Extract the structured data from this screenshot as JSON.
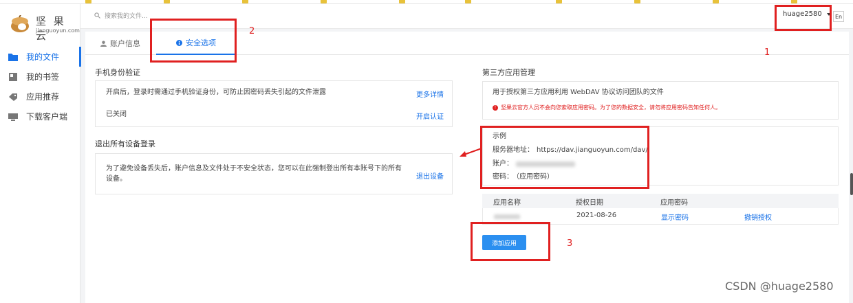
{
  "app": {
    "logo_name": "坚 果 云",
    "logo_url": "jianguoyun.com"
  },
  "sidebar": {
    "items": [
      {
        "label": "我的文件",
        "icon": "folder-icon",
        "active": true
      },
      {
        "label": "我的书签",
        "icon": "bookmark-icon",
        "active": false
      },
      {
        "label": "应用推荐",
        "icon": "tag-icon",
        "active": false
      },
      {
        "label": "下载客户端",
        "icon": "monitor-icon",
        "active": false
      }
    ]
  },
  "header": {
    "search_placeholder": "搜索我的文件...",
    "username": "huage2580",
    "lang_button": "En"
  },
  "tabs": [
    {
      "label": "账户信息",
      "icon": "user-icon",
      "active": false
    },
    {
      "label": "安全选项",
      "icon": "info-icon",
      "active": true
    }
  ],
  "phone_verify": {
    "title": "手机身份验证",
    "desc": "开启后，登录时需通过手机验证身份，可防止因密码丢失引起的文件泄露",
    "more_link": "更多详情",
    "status": "已关闭",
    "enable_link": "开启认证"
  },
  "logout_all": {
    "title": "退出所有设备登录",
    "desc_line1": "为了避免设备丢失后，账户信息及文件处于不安全状态，您可以在此强制登出所有本账号下的所有",
    "desc_line2": "设备。",
    "link": "退出设备"
  },
  "third_party": {
    "title": "第三方应用管理",
    "desc": "用于授权第三方应用利用 WebDAV 协议访问团队的文件",
    "warning": "坚果云官方人员不会向您索取应用密码。为了您的数据安全，请勿将应用密码告知任何人。",
    "example_title": "示例",
    "server_label": "服务器地址：",
    "server_value": "https://dav.jianguoyun.com/dav/",
    "account_label": "账户：",
    "password_label": "密码：",
    "password_value": "（应用密码）",
    "table_headers": [
      "应用名称",
      "授权日期",
      "应用密码"
    ],
    "rows": [
      {
        "date": "2021-08-26",
        "show_password": "显示密码",
        "revoke": "撤销授权"
      }
    ],
    "add_button": "添加应用"
  },
  "annotations": {
    "num1": "1",
    "num2": "2",
    "num3": "3",
    "watermark": "CSDN @huage2580",
    "color": "#e02020"
  }
}
